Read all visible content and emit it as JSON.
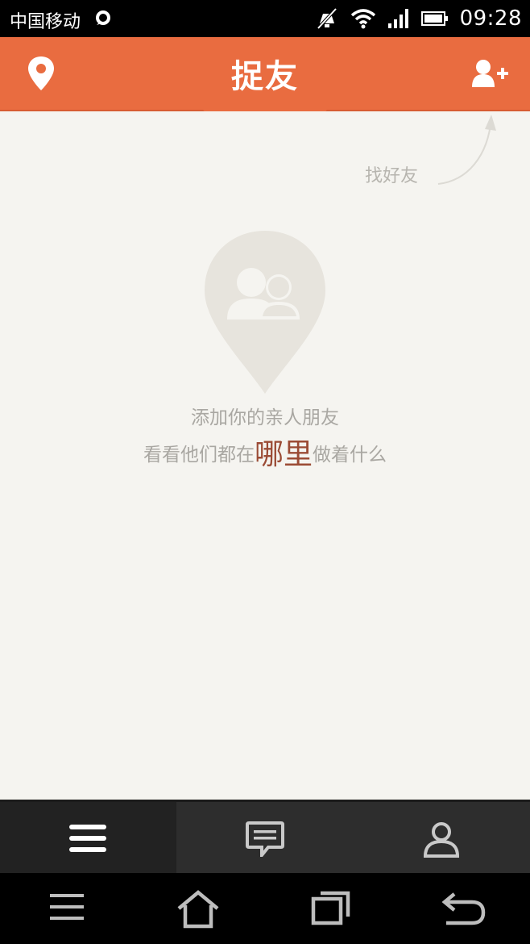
{
  "status_bar": {
    "carrier": "中国移动",
    "time": "09:28",
    "icons": [
      "message-bubble-icon",
      "mute-icon",
      "wifi-icon",
      "signal-icon",
      "battery-icon"
    ]
  },
  "header": {
    "title": "捉友",
    "left_icon": "location-pin-icon",
    "right_icon": "add-friend-icon",
    "background": "#e96c40"
  },
  "main": {
    "hint": "找好友",
    "empty_line1": "添加你的亲人朋友",
    "empty_line2_before": "看看他们都在",
    "empty_line2_highlight": "哪里",
    "empty_line2_after": "做着什么",
    "highlight_color": "#9b4b35",
    "background": "#f5f4f0"
  },
  "tabbar": {
    "tabs": [
      {
        "icon": "menu-icon",
        "active": true
      },
      {
        "icon": "chat-icon",
        "active": false
      },
      {
        "icon": "profile-icon",
        "active": false
      }
    ]
  },
  "navbar": {
    "buttons": [
      "menu-icon",
      "home-icon",
      "recent-apps-icon",
      "back-icon"
    ]
  }
}
